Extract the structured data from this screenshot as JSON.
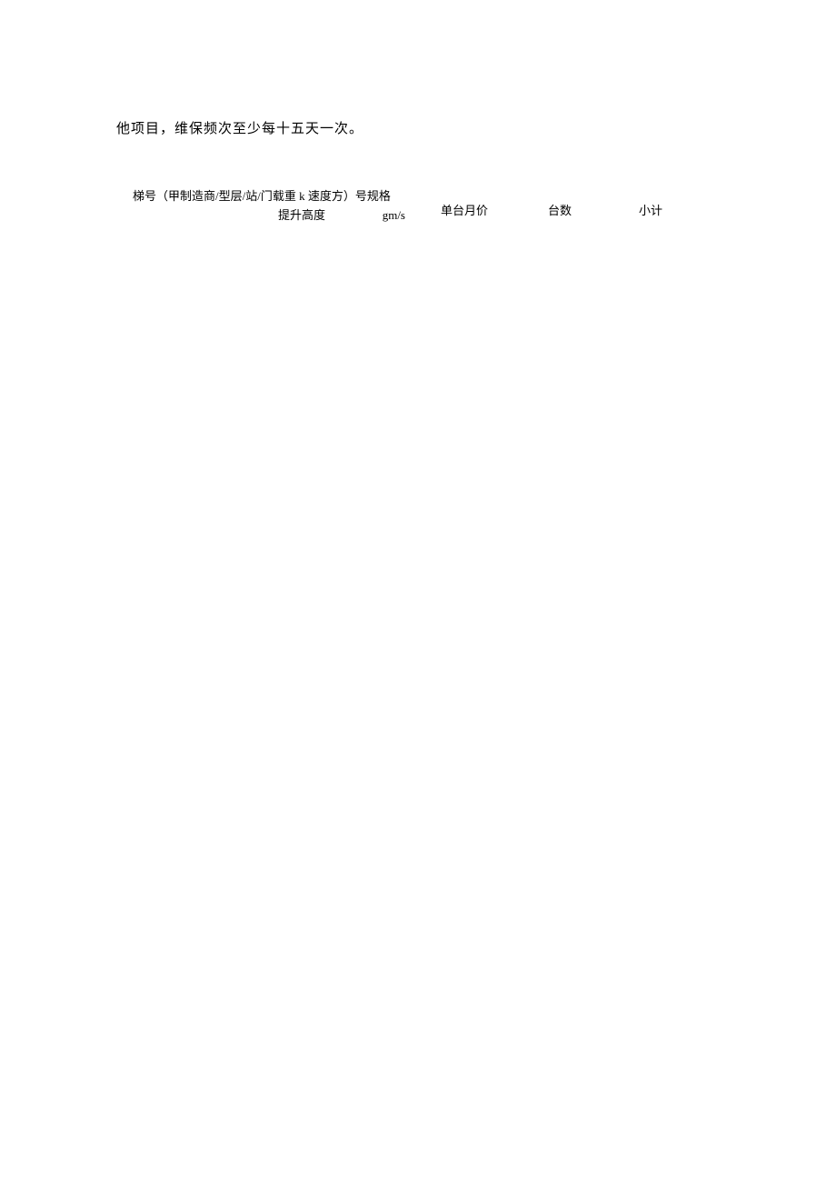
{
  "body": {
    "paragraph": "他项目，维保频次至少每十五天一次。",
    "table": {
      "header": {
        "col1_line1": "梯号（甲制造商/型层/站/门载重 k 速度方）号规格",
        "col1_line2_left": "提升高度",
        "col1_line2_right": "gm/s",
        "col2": "单台月价",
        "col3": "台数",
        "col4": "小计"
      }
    }
  }
}
